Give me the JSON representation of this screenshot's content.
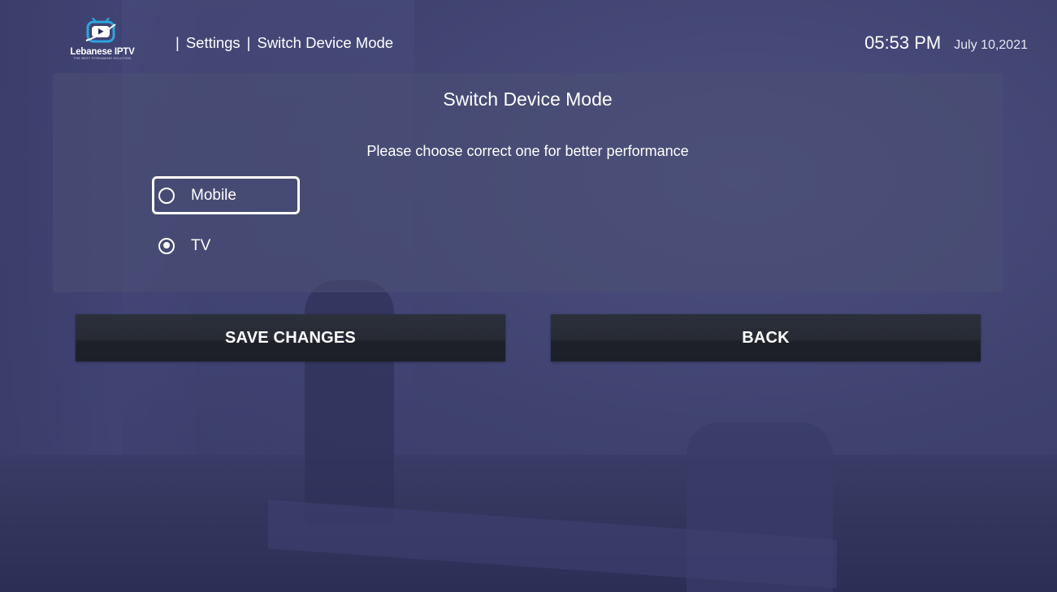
{
  "app": {
    "logo_text": "Lebanese IPTV",
    "logo_tagline": "THE BEST STREAMING SOLUTION"
  },
  "header": {
    "breadcrumb": [
      {
        "sep": "|",
        "label": "Settings"
      },
      {
        "sep": "|",
        "label": "Switch Device Mode"
      }
    ],
    "time": "05:53 PM",
    "date": "July 10,2021"
  },
  "panel": {
    "title": "Switch Device Mode",
    "subtitle": "Please choose correct one for better performance",
    "options": [
      {
        "label": "Mobile",
        "selected": false,
        "focused": true
      },
      {
        "label": "TV",
        "selected": true,
        "focused": false
      }
    ]
  },
  "buttons": {
    "save_label": "SAVE CHANGES",
    "back_label": "BACK"
  },
  "colors": {
    "background": "#3b3d6b",
    "panel": "#4b5073",
    "button": "#272a34",
    "logo_accent": "#2aa7e0"
  },
  "icons": {
    "logo": "tv-play-icon",
    "radio_unchecked": "radio-unchecked-icon",
    "radio_checked": "radio-checked-icon"
  }
}
